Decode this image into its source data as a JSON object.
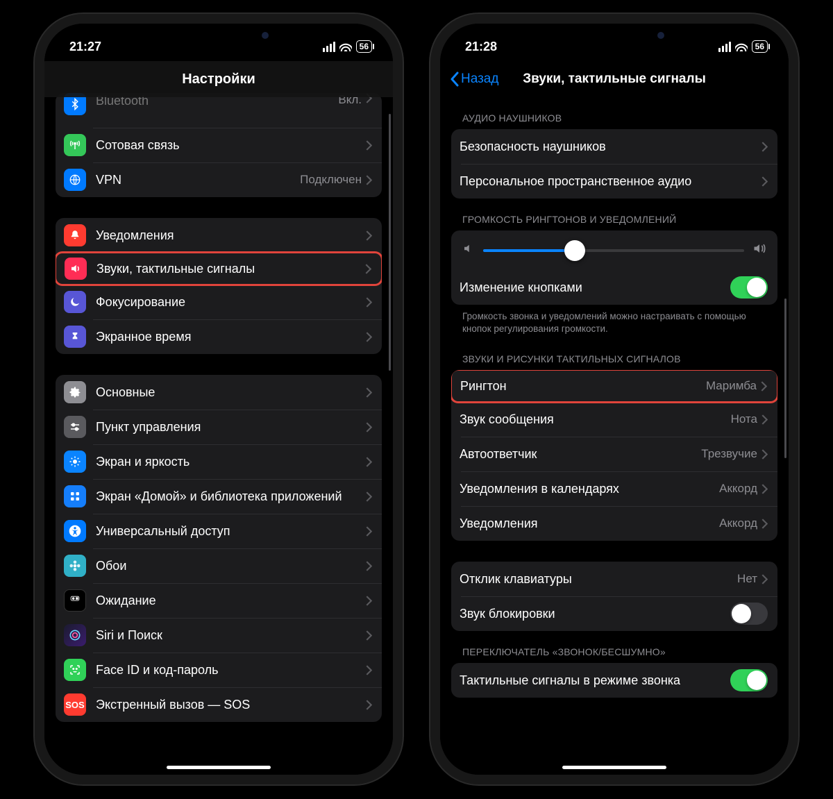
{
  "left": {
    "status": {
      "time": "21:27",
      "battery": "56"
    },
    "nav_title": "Настройки",
    "g1": {
      "bluetooth": {
        "label": "Bluetooth",
        "value": "Вкл."
      },
      "cellular": {
        "label": "Сотовая связь"
      },
      "vpn": {
        "label": "VPN",
        "value": "Подключен"
      }
    },
    "g2": {
      "notifications": {
        "label": "Уведомления"
      },
      "sounds": {
        "label": "Звуки, тактильные сигналы"
      },
      "focus": {
        "label": "Фокусирование"
      },
      "screentime": {
        "label": "Экранное время"
      }
    },
    "g3": {
      "general": {
        "label": "Основные"
      },
      "control": {
        "label": "Пункт управления"
      },
      "display": {
        "label": "Экран и яркость"
      },
      "home": {
        "label": "Экран «Домой» и библиотека приложений"
      },
      "access": {
        "label": "Универсальный доступ"
      },
      "wallpaper": {
        "label": "Обои"
      },
      "standby": {
        "label": "Ожидание"
      },
      "siri": {
        "label": "Siri и Поиск"
      },
      "faceid": {
        "label": "Face ID и код-пароль"
      },
      "sos": {
        "label": "Экстренный вызов — SOS",
        "icon_text": "SOS"
      }
    }
  },
  "right": {
    "status": {
      "time": "21:28",
      "battery": "56"
    },
    "nav_back": "Назад",
    "nav_title": "Звуки, тактильные сигналы",
    "sec_headphones": "АУДИО НАУШНИКОВ",
    "headphones": {
      "safety": {
        "label": "Безопасность наушников"
      },
      "spatial": {
        "label": "Персональное пространственное аудио"
      }
    },
    "sec_volume": "ГРОМКОСТЬ РИНГТОНОВ И УВЕДОМЛЕНИЙ",
    "volume_row": {
      "label": "Изменение кнопками"
    },
    "volume_footer": "Громкость звонка и уведомлений можно настраивать с помощью кнопок регулирования громкости.",
    "sec_sounds": "ЗВУКИ И РИСУНКИ ТАКТИЛЬНЫХ СИГНАЛОВ",
    "sounds": {
      "ringtone": {
        "label": "Рингтон",
        "value": "Маримба"
      },
      "text": {
        "label": "Звук сообщения",
        "value": "Нота"
      },
      "voicemail": {
        "label": "Автоответчик",
        "value": "Трезвучие"
      },
      "calendar": {
        "label": "Уведомления в календарях",
        "value": "Аккорд"
      },
      "reminders": {
        "label": "Уведомления",
        "value": "Аккорд"
      }
    },
    "keyboard": {
      "feedback": {
        "label": "Отклик клавиатуры",
        "value": "Нет"
      },
      "lock": {
        "label": "Звук блокировки"
      }
    },
    "sec_ringer": "ПЕРЕКЛЮЧАТЕЛЬ «ЗВОНОК/БЕСШУМНО»",
    "ringer": {
      "haptic": {
        "label": "Тактильные сигналы в режиме звонка"
      }
    }
  }
}
